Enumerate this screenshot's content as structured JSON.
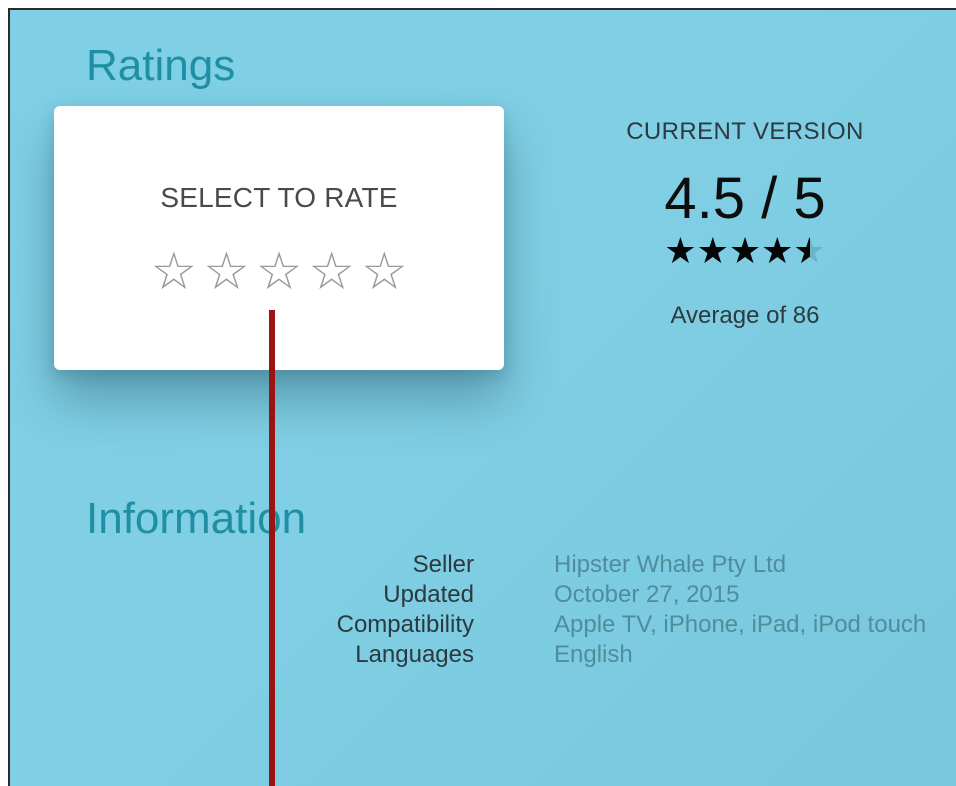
{
  "ratings": {
    "title": "Ratings",
    "rate_card": {
      "label": "SELECT TO RATE",
      "stars": [
        {
          "icon": "star-outline-icon"
        },
        {
          "icon": "star-outline-icon"
        },
        {
          "icon": "star-outline-icon"
        },
        {
          "icon": "star-outline-icon"
        },
        {
          "icon": "star-outline-icon"
        }
      ]
    },
    "current_version": {
      "label": "CURRENT VERSION",
      "score": "4.5 / 5",
      "rating_value": 4.5,
      "rating_max": 5,
      "average": "Average of 86"
    }
  },
  "information": {
    "title": "Information",
    "rows": [
      {
        "key": "Seller",
        "value": "Hipster Whale Pty Ltd"
      },
      {
        "key": "Updated",
        "value": "October 27, 2015"
      },
      {
        "key": "Compatibility",
        "value": "Apple TV, iPhone, iPad, iPod touch"
      },
      {
        "key": "Languages",
        "value": "English"
      }
    ]
  },
  "colors": {
    "background": "#80cfe4",
    "section_title": "#1f8fa3",
    "info_value": "#4f8d9c",
    "pointer_line": "#9b1414"
  }
}
